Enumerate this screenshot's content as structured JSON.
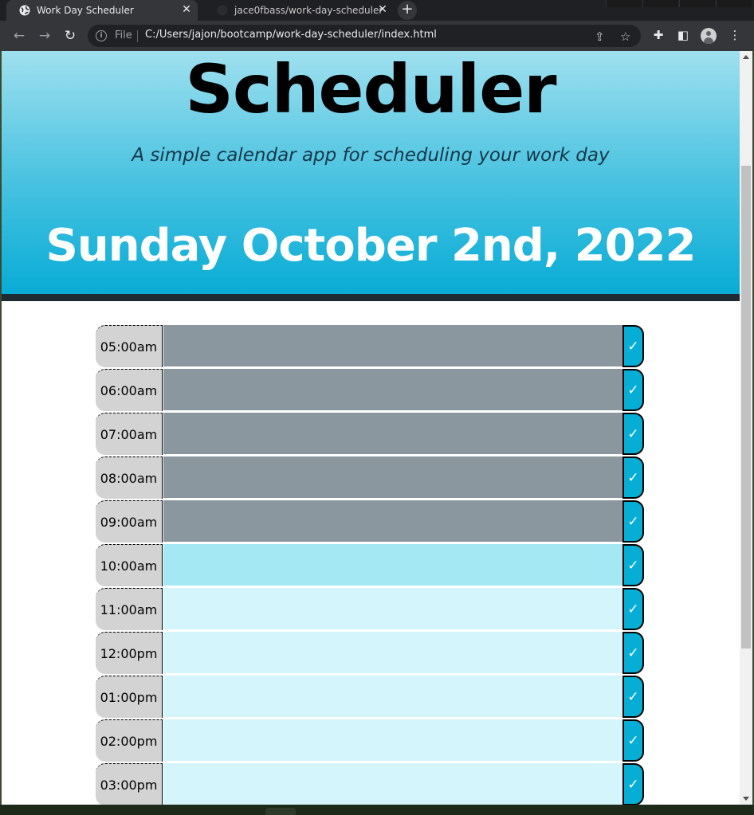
{
  "browser": {
    "tabs": [
      {
        "title": "Work Day Scheduler",
        "active": true
      },
      {
        "title": "jace0fbass/work-day-scheduler",
        "active": false
      }
    ],
    "address": {
      "scheme_label": "File",
      "url": "C:/Users/jajon/bootcamp/work-day-scheduler/index.html"
    }
  },
  "header": {
    "title": "Scheduler",
    "subtitle": "A simple calendar app for scheduling your work day",
    "current_day": "Sunday October 2nd, 2022"
  },
  "timeblocks": [
    {
      "hour": "05:00am",
      "status": "past",
      "text": ""
    },
    {
      "hour": "06:00am",
      "status": "past",
      "text": ""
    },
    {
      "hour": "07:00am",
      "status": "past",
      "text": ""
    },
    {
      "hour": "08:00am",
      "status": "past",
      "text": ""
    },
    {
      "hour": "09:00am",
      "status": "past",
      "text": ""
    },
    {
      "hour": "10:00am",
      "status": "present",
      "text": ""
    },
    {
      "hour": "11:00am",
      "status": "future",
      "text": ""
    },
    {
      "hour": "12:00pm",
      "status": "future",
      "text": ""
    },
    {
      "hour": "01:00pm",
      "status": "future",
      "text": ""
    },
    {
      "hour": "02:00pm",
      "status": "future",
      "text": ""
    },
    {
      "hour": "03:00pm",
      "status": "future",
      "text": ""
    }
  ],
  "save_glyph": "✓",
  "colors": {
    "past": "#8b979f",
    "present": "#a3e8f3",
    "future": "#d5f5fc",
    "save_button": "#06aed5",
    "hour_label": "#d3d3d3"
  }
}
